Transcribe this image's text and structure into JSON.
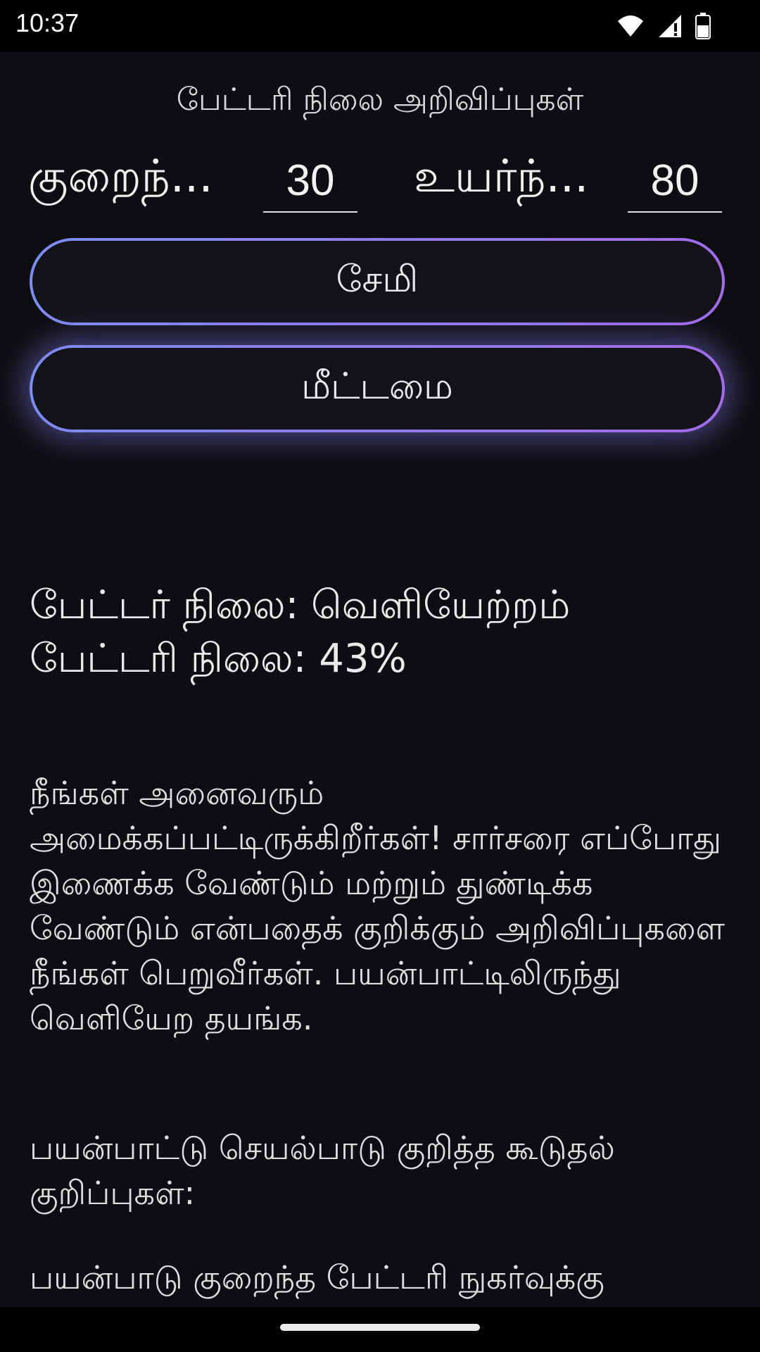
{
  "status_bar": {
    "time": "10:37"
  },
  "app": {
    "title": "பேட்டரி நிலை அறிவிப்புகள்",
    "thresholds": {
      "low_label": "குறைந்...",
      "low_value": "30",
      "high_label": "உயர்ந்...",
      "high_value": "80"
    },
    "buttons": {
      "save": "சேமி",
      "reset": "மீட்டமை"
    },
    "status": {
      "charger_status": "பேட்டர் நிலை:  வெளியேற்றம்",
      "battery_level": "பேட்டரி நிலை: 43%"
    },
    "description": {
      "para1": "நீங்கள் அனைவரும் அமைக்கப்பட்டிருக்கிறீர்கள்! சார்சரை எப்போது இணைக்க வேண்டும் மற்றும் துண்டிக்க வேண்டும் என்பதைக் குறிக்கும் அறிவிப்புகளை நீங்கள் பெறுவீர்கள். பயன்பாட்டிலிருந்து வெளியேற தயங்க.",
      "para2": " பயன்பாட்டு செயல்பாடு குறித்த கூடுதல் குறிப்புகள்:",
      "para3": " பயன்பாடு குறைந்த பேட்டரி நுகர்வுக்கு"
    }
  }
}
